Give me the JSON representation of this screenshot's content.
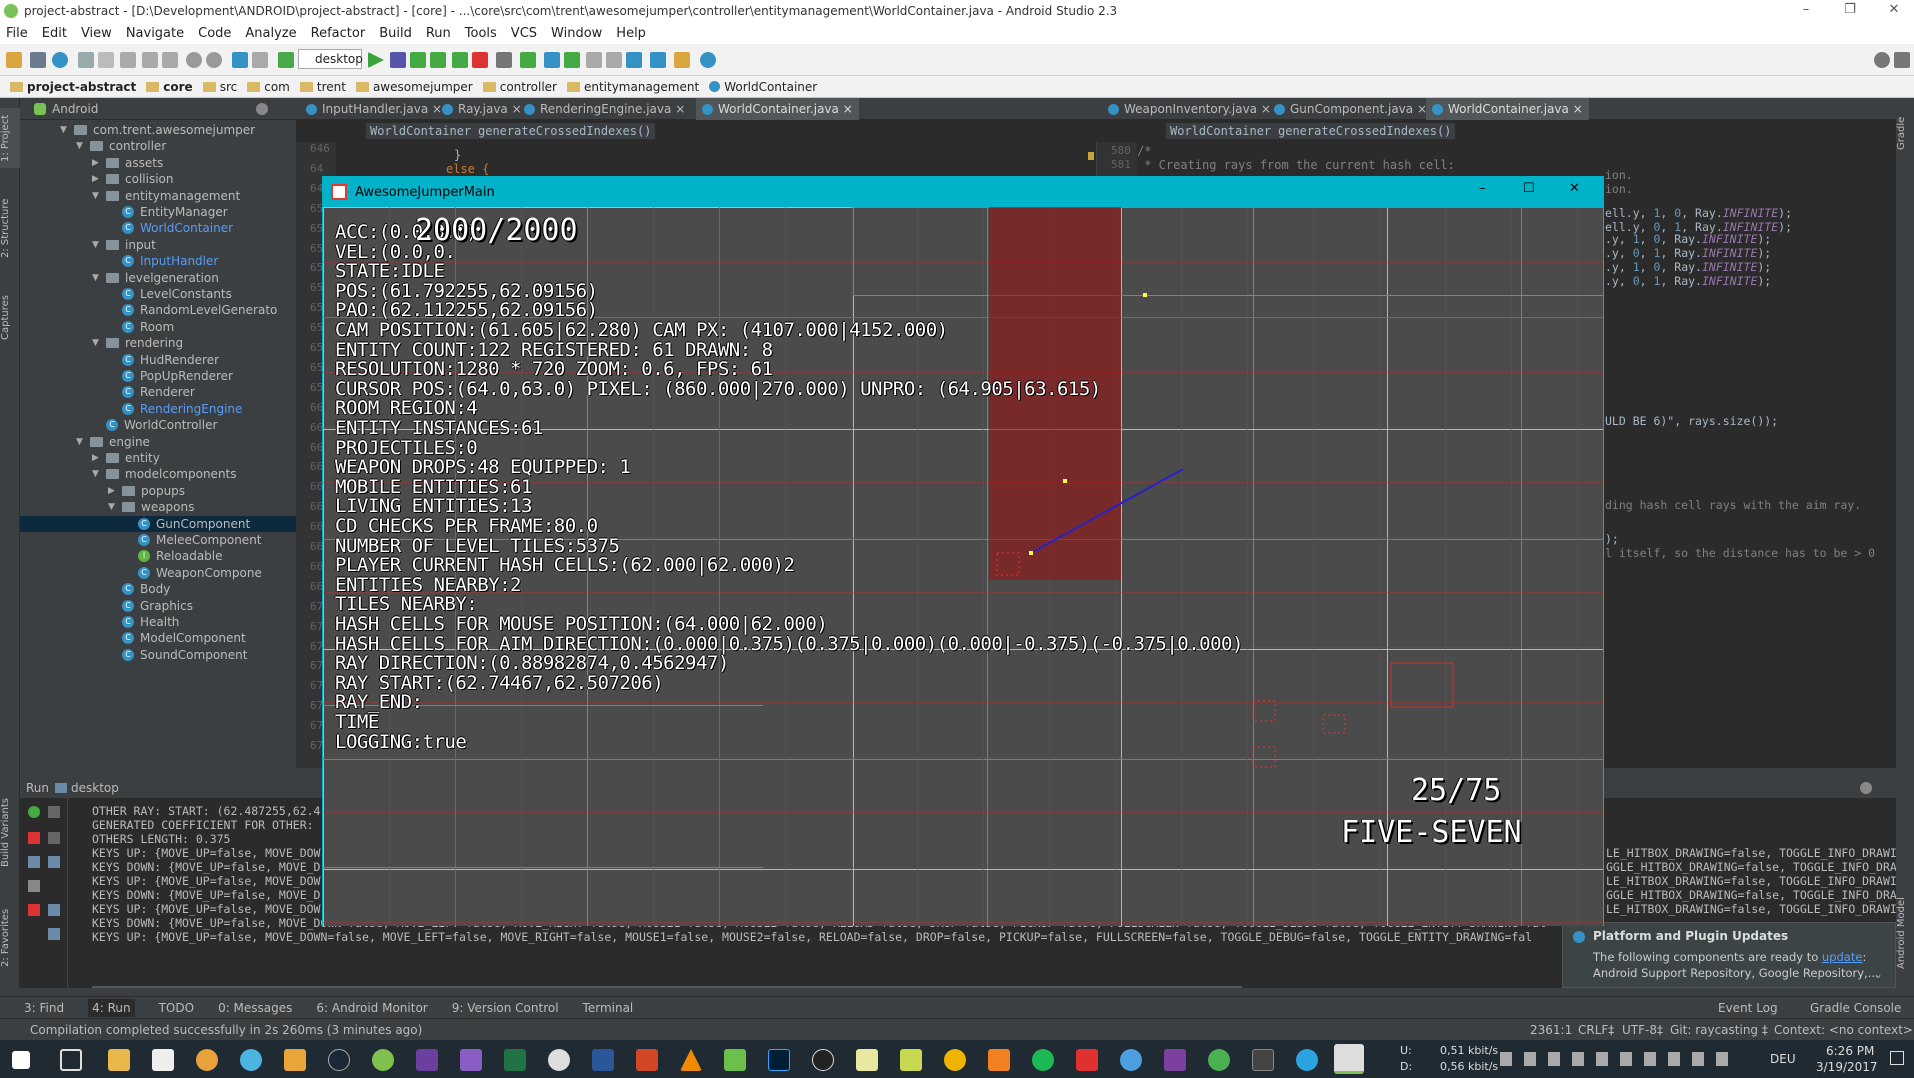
{
  "window": {
    "title": "project-abstract - [D:\\Development\\ANDROID\\project-abstract] - [core] - ...\\core\\src\\com\\trent\\awesomejumper\\controller\\entitymanagement\\WorldContainer.java - Android Studio 2.3"
  },
  "menu": [
    "File",
    "Edit",
    "View",
    "Navigate",
    "Code",
    "Analyze",
    "Refactor",
    "Build",
    "Run",
    "Tools",
    "VCS",
    "Window",
    "Help"
  ],
  "toolbar": {
    "run_config": "desktop"
  },
  "breadcrumbs": [
    "project-abstract",
    "core",
    "src",
    "com",
    "trent",
    "awesomejumper",
    "controller",
    "entitymanagement",
    "WorldContainer"
  ],
  "left_tool_tabs": [
    "1: Project",
    "2: Structure",
    "Captures",
    "Build Variants",
    "2: Favorites"
  ],
  "project_panel": {
    "view": "Android",
    "items": [
      {
        "label": "com.trent.awesomejumper",
        "type": "folder",
        "depth": 0,
        "open": true
      },
      {
        "label": "controller",
        "type": "folder",
        "depth": 1,
        "open": true
      },
      {
        "label": "assets",
        "type": "folder",
        "depth": 2,
        "open": false
      },
      {
        "label": "collision",
        "type": "folder",
        "depth": 2,
        "open": false
      },
      {
        "label": "entitymanagement",
        "type": "folder",
        "depth": 2,
        "open": true
      },
      {
        "label": "EntityManager",
        "type": "class",
        "depth": 3
      },
      {
        "label": "WorldContainer",
        "type": "class",
        "depth": 3,
        "accent": true
      },
      {
        "label": "input",
        "type": "folder",
        "depth": 2,
        "open": true
      },
      {
        "label": "InputHandler",
        "type": "class",
        "depth": 3,
        "accent": true
      },
      {
        "label": "levelgeneration",
        "type": "folder",
        "depth": 2,
        "open": true
      },
      {
        "label": "LevelConstants",
        "type": "class",
        "depth": 3
      },
      {
        "label": "RandomLevelGenerato",
        "type": "class",
        "depth": 3
      },
      {
        "label": "Room",
        "type": "class",
        "depth": 3
      },
      {
        "label": "rendering",
        "type": "folder",
        "depth": 2,
        "open": true
      },
      {
        "label": "HudRenderer",
        "type": "class",
        "depth": 3
      },
      {
        "label": "PopUpRenderer",
        "type": "class",
        "depth": 3
      },
      {
        "label": "Renderer",
        "type": "class",
        "depth": 3
      },
      {
        "label": "RenderingEngine",
        "type": "class",
        "depth": 3,
        "accent": true
      },
      {
        "label": "WorldController",
        "type": "class",
        "depth": 2
      },
      {
        "label": "engine",
        "type": "folder",
        "depth": 1,
        "open": true
      },
      {
        "label": "entity",
        "type": "folder",
        "depth": 2,
        "open": false
      },
      {
        "label": "modelcomponents",
        "type": "folder",
        "depth": 2,
        "open": true
      },
      {
        "label": "popups",
        "type": "folder",
        "depth": 3,
        "open": false
      },
      {
        "label": "weapons",
        "type": "folder",
        "depth": 3,
        "open": true
      },
      {
        "label": "GunComponent",
        "type": "class",
        "depth": 4,
        "selected": true
      },
      {
        "label": "MeleeComponent",
        "type": "class",
        "depth": 4
      },
      {
        "label": "Reloadable",
        "type": "interface",
        "depth": 4
      },
      {
        "label": "WeaponCompone",
        "type": "class",
        "depth": 4
      },
      {
        "label": "Body",
        "type": "class",
        "depth": 3
      },
      {
        "label": "Graphics",
        "type": "class",
        "depth": 3
      },
      {
        "label": "Health",
        "type": "class",
        "depth": 3
      },
      {
        "label": "ModelComponent",
        "type": "class",
        "depth": 3
      },
      {
        "label": "SoundComponent",
        "type": "class",
        "depth": 3
      }
    ]
  },
  "editor_left": {
    "tabs": [
      {
        "label": "InputHandler.java",
        "active": false
      },
      {
        "label": "Ray.java",
        "active": false
      },
      {
        "label": "RenderingEngine.java",
        "active": false
      },
      {
        "label": "WorldContainer.java",
        "active": true
      }
    ],
    "crumbs": [
      "WorldContainer",
      "generateCrossedIndexes()"
    ],
    "line_numbers": [
      "646",
      "64",
      "64",
      "65",
      "65",
      "65",
      "65",
      "65",
      "65",
      "65",
      "65",
      "65",
      "65",
      "66",
      "66",
      "66",
      "66",
      "66",
      "66",
      "66",
      "66",
      "66",
      "66",
      "67",
      "67",
      "67",
      "67",
      "67",
      "67",
      "67",
      "67"
    ],
    "top_lines": [
      "}",
      "else {"
    ]
  },
  "editor_right": {
    "tabs": [
      {
        "label": "WeaponInventory.java",
        "active": false
      },
      {
        "label": "GunComponent.java",
        "active": false
      },
      {
        "label": "WorldContainer.java",
        "active": true
      }
    ],
    "crumbs": [
      "WorldContainer",
      "generateCrossedIndexes()"
    ],
    "line_numbers": [
      "580",
      "581"
    ],
    "top_lines": [
      "/*",
      " * Creating rays from the current hash cell:"
    ],
    "visible_fragments": [
      {
        "text": "ion.",
        "kind": "comment"
      },
      {
        "text": "ion.",
        "kind": "comment"
      },
      {
        "text": "ell.y, 1, 0, Ray.INFINITE);",
        "kind": "code"
      },
      {
        "text": "ell.y, 0, 1, Ray.INFINITE);",
        "kind": "code"
      },
      {
        "text": ".y, 1, 0, Ray.INFINITE);",
        "kind": "code"
      },
      {
        "text": ".y, 0, 1, Ray.INFINITE);",
        "kind": "code"
      },
      {
        "text": ".y, 1, 0, Ray.INFINITE);",
        "kind": "code"
      },
      {
        "text": ".y, 0, 1, Ray.INFINITE);",
        "kind": "code"
      },
      {
        "text": "ULD BE 6)\", rays.size());",
        "kind": "code"
      },
      {
        "text": "ding hash cell rays with the aim ray.",
        "kind": "comment"
      },
      {
        "text": ");",
        "kind": "code"
      },
      {
        "text": "l itself, so the distance has to be > 0",
        "kind": "comment"
      }
    ]
  },
  "run_panel": {
    "title": "Run",
    "config": "desktop",
    "lines": [
      "OTHER RAY: START: (62.487255,62.4",
      "GENERATED COEFFICIENT FOR OTHER:",
      "OTHERS LENGTH: 0.375",
      "KEYS UP: {MOVE_UP=false, MOVE_DOW",
      "KEYS DOWN: {MOVE_UP=false, MOVE_D",
      "KEYS UP: {MOVE_UP=false, MOVE_DOW",
      "KEYS DOWN: {MOVE_UP=false, MOVE_D",
      "KEYS UP: {MOVE_UP=false, MOVE_DOW",
      "KEYS DOWN: {MOVE_UP=false, MOVE_DOWN=false, MOVE_LEFT=false, MOVE_RIGHT=false, MOUSE1=false, MOUSE2=false, RELOAD=false, DROP=false, PICKUP=false, FULLSCREEN=false, TOGGLE_DEBUG=false, TOGGLE_ENTITY_DRAWING=fal",
      "KEYS UP: {MOVE_UP=false, MOVE_DOWN=false, MOVE_LEFT=false, MOVE_RIGHT=false, MOUSE1=false, MOUSE2=false, RELOAD=false, DROP=false, PICKUP=false, FULLSCREEN=false, TOGGLE_DEBUG=false, TOGGLE_ENTITY_DRAWING=fal"
    ],
    "right_fragments": [
      "LE_HITBOX_DRAWING=false, TOGGLE_INFO_DRAWI",
      "GGLE_HITBOX_DRAWING=false, TOGGLE_INFO_DRA",
      "LE_HITBOX_DRAWING=false, TOGGLE_INFO_DRAWI",
      "GGLE_HITBOX_DRAWING=false, TOGGLE_INFO_DRA",
      "LE_HITBOX_DRAWING=false, TOGGLE_INFO_DRAWI"
    ]
  },
  "notification": {
    "title": "Platform and Plugin Updates",
    "text_before": "The following components are ready to ",
    "link": "update",
    "text_after": ": Android Support Repository, Google Repository,..."
  },
  "bottom_tabs": [
    "3: Find",
    "4: Run",
    "TODO",
    "0: Messages",
    "6: Android Monitor",
    "9: Version Control",
    "Terminal"
  ],
  "bottom_tabs_right": [
    "Event Log",
    "Gradle Console"
  ],
  "status": {
    "message": "Compilation completed successfully in 2s 260ms (3 minutes ago)",
    "position": "2361:1",
    "line_sep": "CRLF‡",
    "encoding": "UTF-8‡",
    "git": "Git: raycasting ‡",
    "context": "Context: <no context>"
  },
  "right_tool_tabs": [
    "Gradle",
    "Android Model"
  ],
  "game": {
    "window_title": "AwesomeJumperMain",
    "health": "2000/2000",
    "ammo": "25/75",
    "weapon": "FIVE-SEVEN",
    "debug_lines": [
      "ACC:(0.0,0.0)",
      "VEL:(0.0,0.",
      "STATE:IDLE",
      "POS:(61.792255,62.09156)",
      "PAO:(62.112255,62.09156)",
      "CAM POSITION:(61.605|62.280) CAM PX: (4107.000|4152.000)",
      "ENTITY COUNT:122 REGISTERED: 61 DRAWN: 8",
      "RESOLUTION:1280 * 720 ZOOM: 0.6, FPS: 61",
      "CURSOR POS:(64.0,63.0) PIXEL: (860.000|270.000) UNPRO: (64.905|63.615)",
      "ROOM REGION:4",
      "ENTITY INSTANCES:61",
      "PROJECTILES:0",
      "WEAPON DROPS:48 EQUIPPED: 1",
      "MOBILE ENTITIES:61",
      "LIVING ENTITIES:13",
      "CD CHECKS PER FRAME:80.0",
      "NUMBER OF LEVEL TILES:5375",
      "PLAYER CURRENT HASH CELLS:(62.000|62.000)2",
      "ENTITIES NEARBY:2",
      "TILES NEARBY:",
      "HASH CELLS FOR MOUSE POSITION:(64.000|62.000)",
      "HASH CELLS FOR AIM DIRECTION:(0.000|0.375)(0.375|0.000)(0.000|-0.375)(-0.375|0.000)",
      "RAY DIRECTION:(0.88982874,0.4562947)",
      "RAY START:(62.74467,62.507206)",
      "RAY_END:",
      "TIME",
      "LOGGING:true"
    ]
  },
  "taskbar": {
    "net_up": "0,51 kbit/s",
    "net_down": "0,56 kbit/s",
    "net_up_label": "U:",
    "net_down_label": "D:",
    "lang": "DEU",
    "time": "6:26 PM",
    "date": "3/19/2017"
  },
  "colors": {
    "ide_bg": "#2b2b2b",
    "panel_bg": "#3c3f41",
    "game_title": "#00b3c8",
    "grid_yellow": "#c8c832",
    "grid_green": "#32b432",
    "grid_red": "#b43232",
    "grid_magenta": "#c850c8",
    "highlight_cell": "#8c2a2a"
  }
}
